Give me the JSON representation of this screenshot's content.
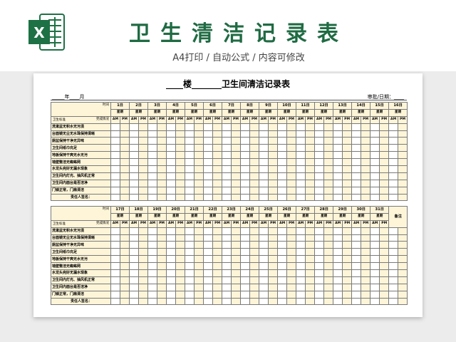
{
  "header": {
    "title": "卫生清洁记录表",
    "subtitle": "A4打印 / 自动公式 / 内容可修改"
  },
  "sheet": {
    "title": "____楼_______卫生间清洁记录表",
    "date_field": "_____年____月",
    "approval": "审批/日期：____",
    "labels": {
      "time": "时间",
      "status": "完成情况",
      "standard": "卫生标准",
      "weekday": "星期",
      "am": "AM",
      "pm": "PM",
      "signature": "责任人签名：",
      "remarks": "备注"
    },
    "block1_days": [
      "1日",
      "2日",
      "3日",
      "4日",
      "5日",
      "6日",
      "7日",
      "8日",
      "9日",
      "10日",
      "11日",
      "12日",
      "13日",
      "14日",
      "15日",
      "16日"
    ],
    "block2_days": [
      "17日",
      "18日",
      "19日",
      "20日",
      "21日",
      "22日",
      "23日",
      "24日",
      "25日",
      "26日",
      "27日",
      "28日",
      "29日",
      "30日",
      "31日"
    ],
    "standards": [
      "洗漱盆无积水无污渍",
      "台面镜无尘无水珠保持清晰",
      "厕盆保持干净无异味",
      "卫生间纸巾充足",
      "地板保持干爽无水无污",
      "墙壁整洁无蜘蛛网",
      "水龙头完好无漏水现象",
      "卫生间内灯光、抽风机正常",
      "卫生间内面台是否洁净",
      "门锁正常，门扇清洁"
    ]
  },
  "colors": {
    "title_green": "#1f6b43",
    "cell_yellow": "#fef5d8",
    "excel_green": "#1e7145"
  },
  "icons": {
    "logo": "excel-logo-icon"
  }
}
